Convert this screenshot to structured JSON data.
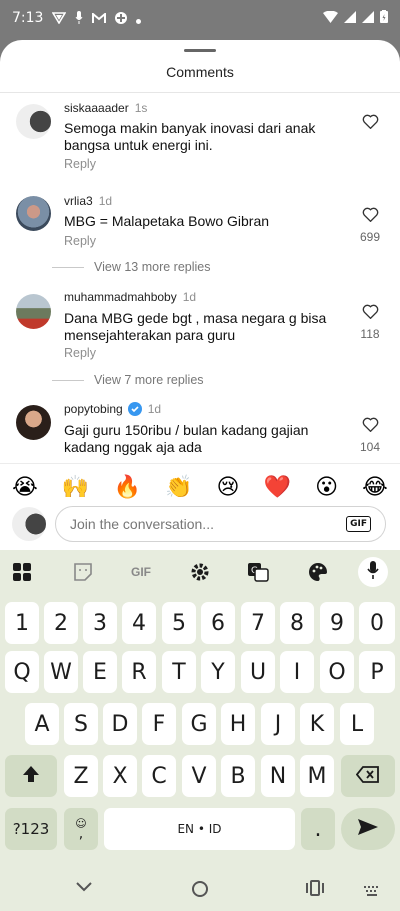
{
  "status": {
    "time": "7:13"
  },
  "sheet": {
    "title": "Comments"
  },
  "comments": [
    {
      "user": "siskaaaader",
      "age": "1s",
      "text": "Semoga makin banyak inovasi dari anak bangsa untuk energi ini.",
      "reply": "Reply",
      "likes": ""
    },
    {
      "user": "vrlia3",
      "age": "1d",
      "text": "MBG = Malapetaka Bowo Gibran",
      "reply": "Reply",
      "likes": "699",
      "more": "View 13 more replies"
    },
    {
      "user": "muhammadmahboby",
      "age": "1d",
      "text": "Dana MBG gede bgt , masa negara g bisa mensejahterakan para guru",
      "reply": "Reply",
      "likes": "118",
      "more": "View 7 more replies"
    },
    {
      "user": "popytobing",
      "age": "1d",
      "text": "Gaji guru 150ribu / bulan kadang gajian kadang nggak aja ada",
      "reply": "Reply",
      "likes": "104"
    }
  ],
  "reactions": [
    "😭",
    "🙌",
    "🔥",
    "👏",
    "😢",
    "❤️",
    "😮",
    "😂"
  ],
  "composer": {
    "placeholder": "Join the conversation...",
    "gif": "GIF"
  },
  "keyboard": {
    "toolbar_gif": "GIF",
    "row1": [
      "1",
      "2",
      "3",
      "4",
      "5",
      "6",
      "7",
      "8",
      "9",
      "0"
    ],
    "row2": [
      "Q",
      "W",
      "E",
      "R",
      "T",
      "Y",
      "U",
      "I",
      "O",
      "P"
    ],
    "row3": [
      "A",
      "S",
      "D",
      "F",
      "G",
      "H",
      "J",
      "K",
      "L"
    ],
    "row4": [
      "Z",
      "X",
      "C",
      "V",
      "B",
      "N",
      "M"
    ],
    "symbols": "?123",
    "comma": ",",
    "space": "EN • ID",
    "period": "."
  }
}
